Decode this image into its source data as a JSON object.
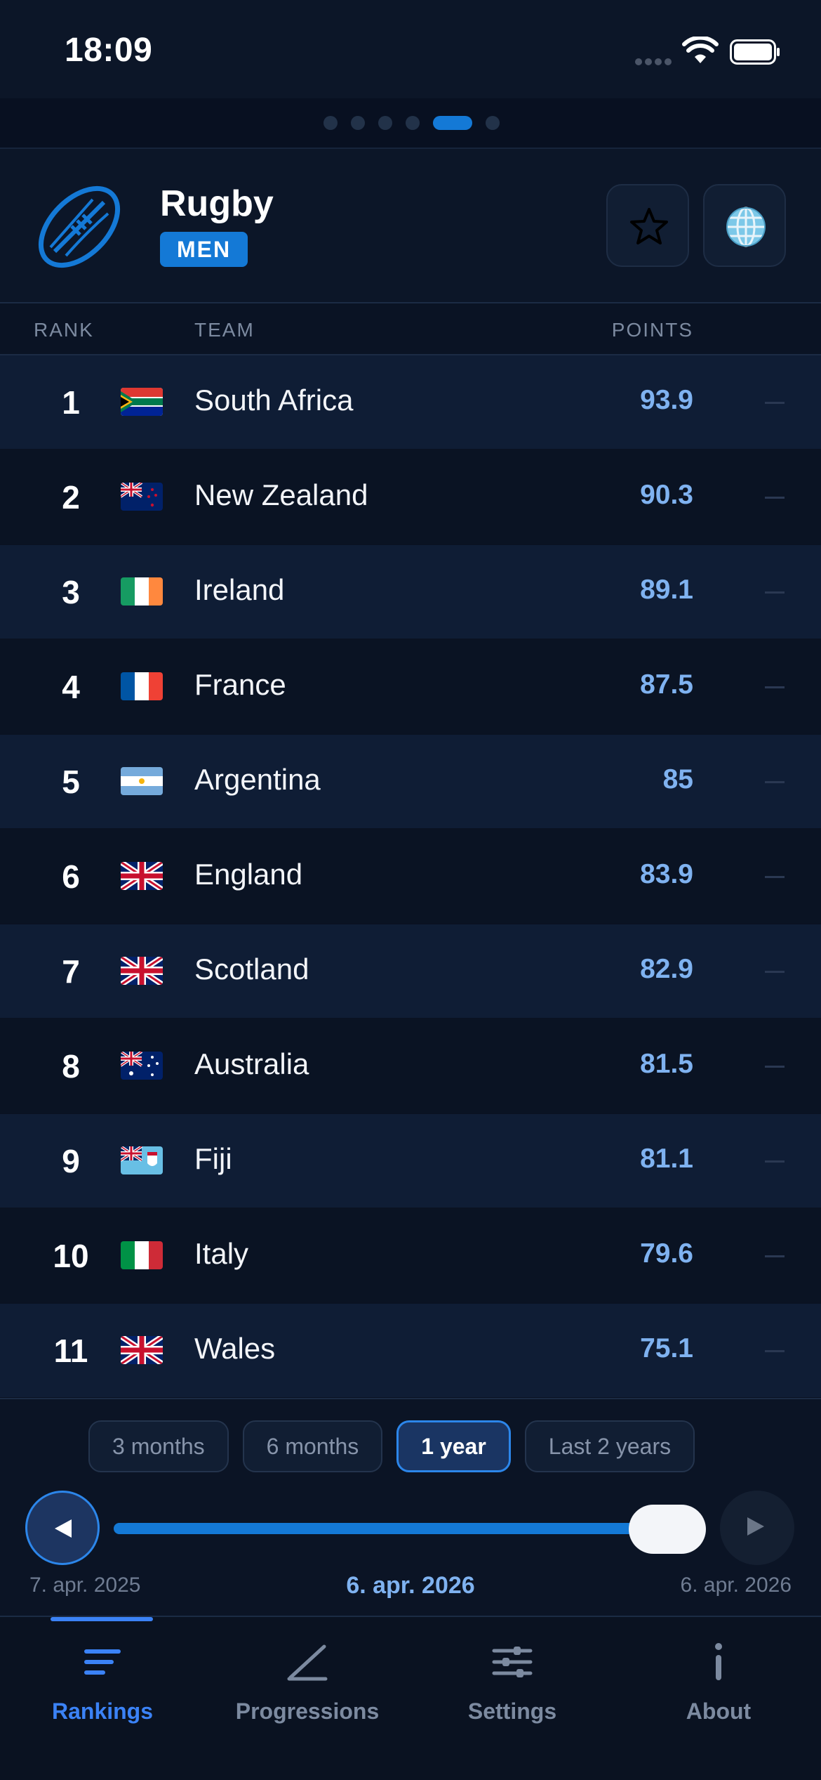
{
  "status_bar": {
    "time": "18:09"
  },
  "header": {
    "sport": "Rugby",
    "gender": "MEN"
  },
  "columns": {
    "rank": "RANK",
    "team": "TEAM",
    "points": "POINTS"
  },
  "rankings": [
    {
      "rank": "1",
      "team": "South Africa",
      "points": "93.9",
      "trend": "—",
      "flag": "south-africa-flag"
    },
    {
      "rank": "2",
      "team": "New Zealand",
      "points": "90.3",
      "trend": "—",
      "flag": "new-zealand-flag"
    },
    {
      "rank": "3",
      "team": "Ireland",
      "points": "89.1",
      "trend": "—",
      "flag": "ireland-flag"
    },
    {
      "rank": "4",
      "team": "France",
      "points": "87.5",
      "trend": "—",
      "flag": "france-flag"
    },
    {
      "rank": "5",
      "team": "Argentina",
      "points": "85",
      "trend": "—",
      "flag": "argentina-flag"
    },
    {
      "rank": "6",
      "team": "England",
      "points": "83.9",
      "trend": "—",
      "flag": "uk-flag"
    },
    {
      "rank": "7",
      "team": "Scotland",
      "points": "82.9",
      "trend": "—",
      "flag": "uk-flag"
    },
    {
      "rank": "8",
      "team": "Australia",
      "points": "81.5",
      "trend": "—",
      "flag": "australia-flag"
    },
    {
      "rank": "9",
      "team": "Fiji",
      "points": "81.1",
      "trend": "—",
      "flag": "fiji-flag"
    },
    {
      "rank": "10",
      "team": "Italy",
      "points": "79.6",
      "trend": "—",
      "flag": "italy-flag"
    },
    {
      "rank": "11",
      "team": "Wales",
      "points": "75.1",
      "trend": "—",
      "flag": "uk-flag"
    }
  ],
  "periods": [
    {
      "label": "3 months",
      "active": false
    },
    {
      "label": "6 months",
      "active": false
    },
    {
      "label": "1 year",
      "active": true
    },
    {
      "label": "Last 2 years",
      "active": false
    }
  ],
  "timeline": {
    "start_date": "7. apr. 2025",
    "current_date": "6. apr. 2026",
    "end_date": "6. apr. 2026",
    "position": 1.0
  },
  "tabs": [
    {
      "label": "Rankings",
      "icon": "rankings-icon",
      "active": true
    },
    {
      "label": "Progressions",
      "icon": "progressions-icon",
      "active": false
    },
    {
      "label": "Settings",
      "icon": "settings-icon",
      "active": false
    },
    {
      "label": "About",
      "icon": "about-icon",
      "active": false
    }
  ],
  "colors": {
    "accent": "#1479d6",
    "background": "#0b1425",
    "points": "#7fb2f0",
    "tab_active": "#3b82f6"
  }
}
